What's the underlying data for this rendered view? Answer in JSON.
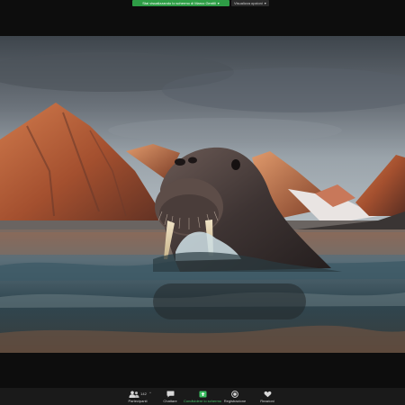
{
  "banner": {
    "share_label": "Stai visualizzando lo schermo di Marco Gentili",
    "view_options_label": "Visualizza opzioni"
  },
  "toolbar": {
    "participants_label": "Partecipanti",
    "participants_count": "142",
    "chat_label": "Chattare",
    "share_label": "Condividere lo schermo",
    "record_label": "Registrazione",
    "reactions_label": "Reazioni"
  },
  "colors": {
    "share_green": "#2e9d46",
    "toolbar_bg": "#1a1a1a"
  },
  "icons": {
    "participants": "people-icon",
    "chat": "speech-bubble-icon",
    "share": "share-screen-icon",
    "record": "record-icon",
    "reactions": "heart-icon"
  }
}
